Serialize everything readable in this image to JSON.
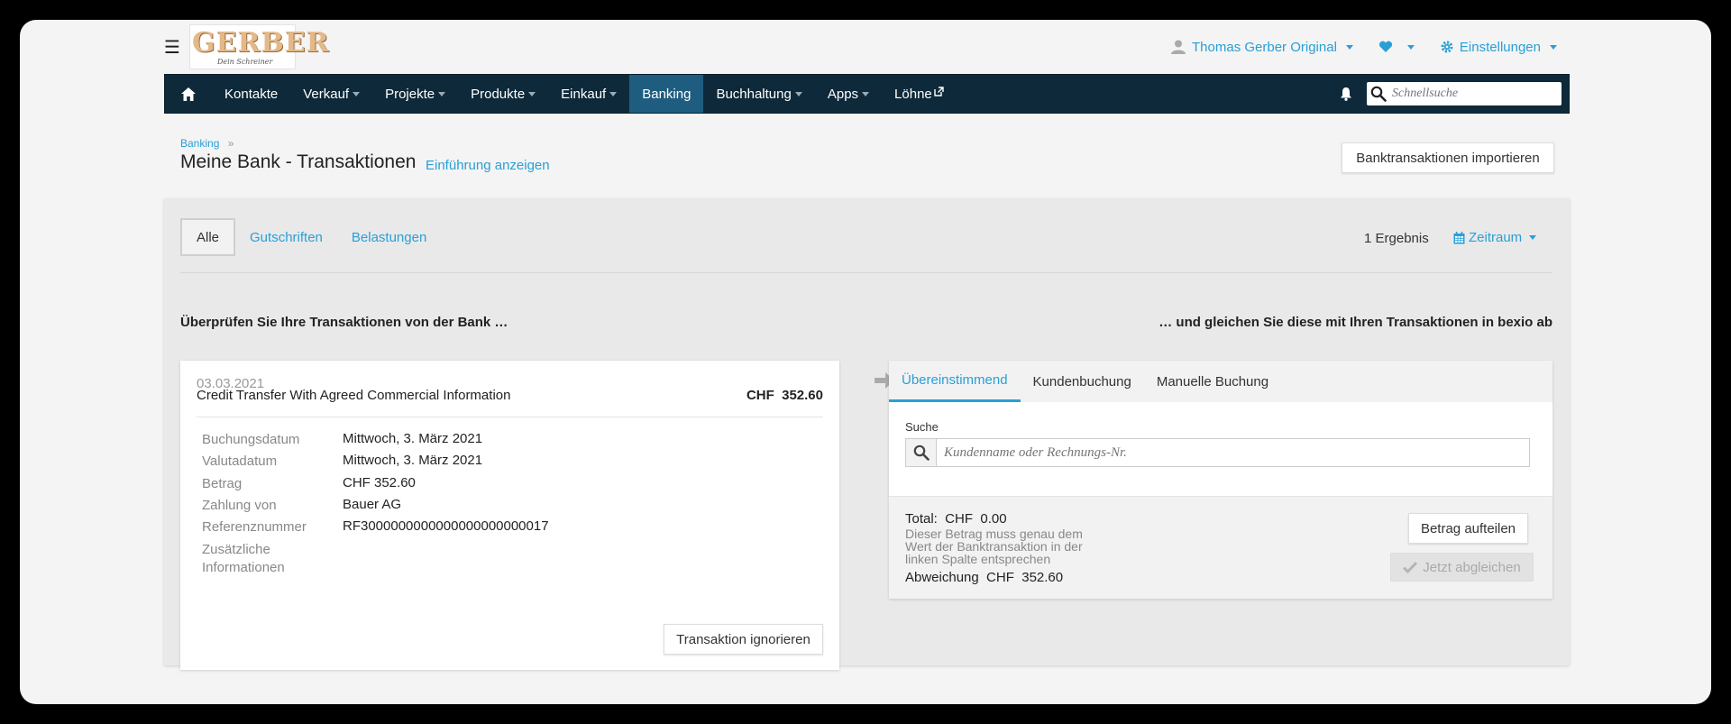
{
  "topbar": {
    "user_name": "Thomas Gerber Original",
    "settings_label": "Einstellungen",
    "logo_text": "GERBER",
    "logo_sub": "Dein Schreiner"
  },
  "nav": {
    "items": [
      {
        "label": "Kontakte",
        "dropdown": false
      },
      {
        "label": "Verkauf",
        "dropdown": true
      },
      {
        "label": "Projekte",
        "dropdown": true
      },
      {
        "label": "Produkte",
        "dropdown": true
      },
      {
        "label": "Einkauf",
        "dropdown": true
      },
      {
        "label": "Banking",
        "dropdown": false,
        "active": true
      },
      {
        "label": "Buchhaltung",
        "dropdown": true
      },
      {
        "label": "Apps",
        "dropdown": true
      },
      {
        "label": "Löhne",
        "dropdown": false,
        "external": true
      }
    ],
    "search_placeholder": "Schnellsuche"
  },
  "header": {
    "breadcrumb": "Banking",
    "breadcrumb_sep": "»",
    "title": "Meine Bank - Transaktionen",
    "intro_link": "Einführung anzeigen",
    "import_button": "Banktransaktionen importieren"
  },
  "filters": {
    "tabs": [
      "Alle",
      "Gutschriften",
      "Belastungen"
    ],
    "active_tab": "Alle",
    "result_count": "1 Ergebnis",
    "period_label": "Zeitraum"
  },
  "instructions": {
    "left": "Überprüfen Sie Ihre Transaktionen von der Bank …",
    "right": "… und gleichen Sie diese mit Ihren Transaktionen in bexio ab"
  },
  "transaction": {
    "date": "03.03.2021",
    "description": "Credit Transfer With Agreed Commercial Information",
    "amount": "CHF  352.60",
    "details": [
      {
        "key": "Buchungsdatum",
        "value": "Mittwoch, 3. März 2021"
      },
      {
        "key": "Valutadatum",
        "value": "Mittwoch, 3. März 2021"
      },
      {
        "key": "Betrag",
        "value": "CHF 352.60"
      },
      {
        "key": "Zahlung von",
        "value": "Bauer AG"
      },
      {
        "key": "Referenznummer",
        "value": "RF3000000000000000000000017"
      },
      {
        "key": "Zusätzliche Informationen",
        "value": ""
      }
    ],
    "ignore_button": "Transaktion ignorieren"
  },
  "match": {
    "tabs": [
      "Übereinstimmend",
      "Kundenbuchung",
      "Manuelle Buchung"
    ],
    "active_tab": "Übereinstimmend",
    "search_label": "Suche",
    "search_placeholder": "Kundenname oder Rechnungs-Nr.",
    "total": "Total:  CHF  0.00",
    "note": "Dieser Betrag muss genau dem Wert der Banktransaktion in der linken Spalte entsprechen",
    "difference": "Abweichung  CHF  352.60",
    "split_button": "Betrag aufteilen",
    "match_button": "Jetzt abgleichen"
  },
  "colors": {
    "accent": "#2a9fd6",
    "nav_bg": "#0e2a3a",
    "nav_active": "#1f5d80"
  }
}
